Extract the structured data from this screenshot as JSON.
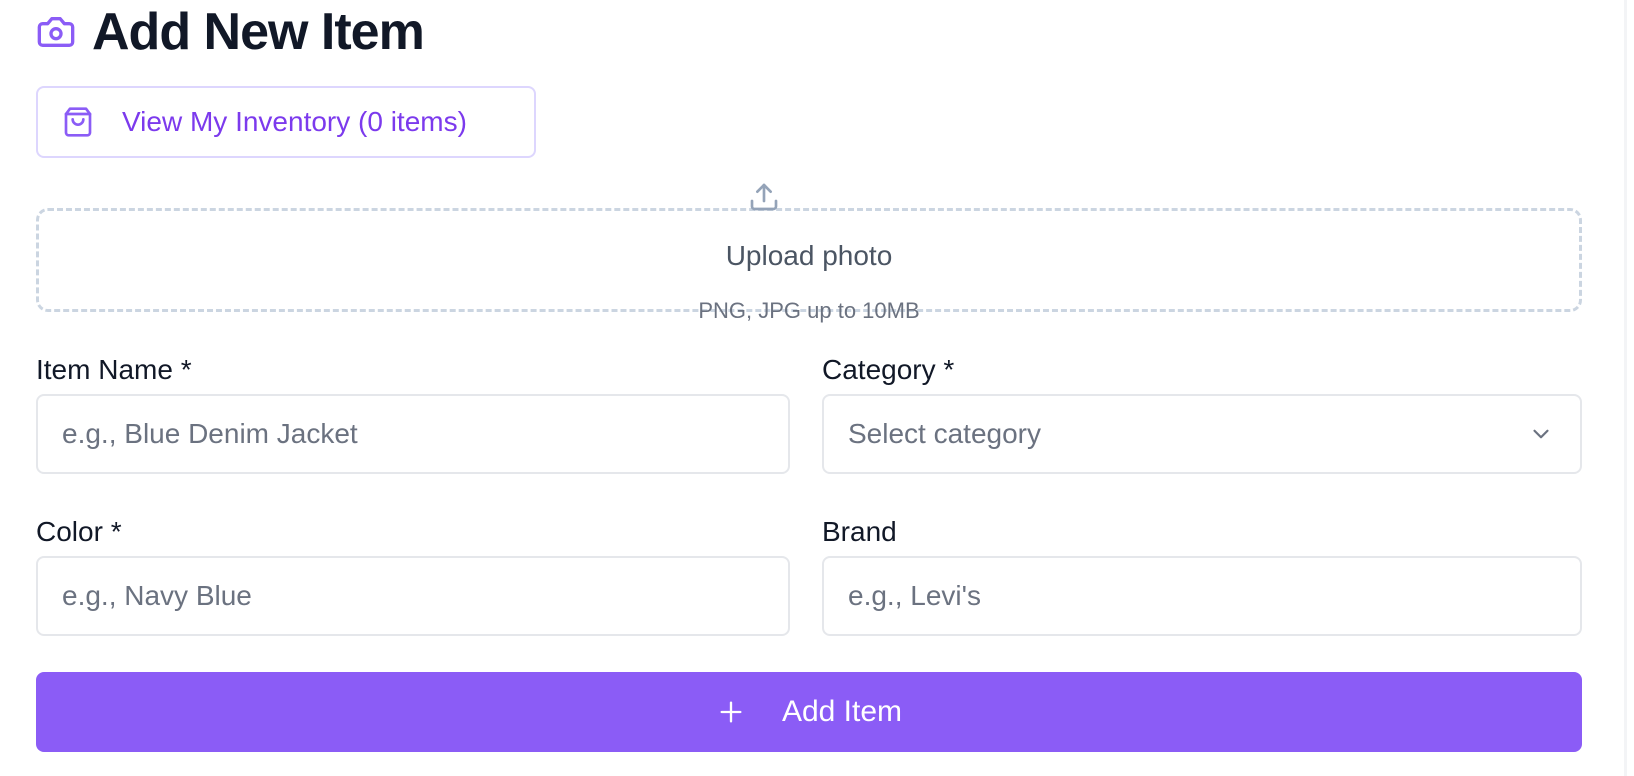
{
  "header": {
    "title": "Add New Item",
    "icon": "camera-icon"
  },
  "inventory_button": {
    "label": "View My Inventory (0 items)",
    "icon": "shopping-bag-icon"
  },
  "upload": {
    "icon": "upload-icon",
    "title": "Upload photo",
    "subtitle": "PNG, JPG up to 10MB"
  },
  "form": {
    "item_name": {
      "label": "Item Name *",
      "placeholder": "e.g., Blue Denim Jacket",
      "value": ""
    },
    "category": {
      "label": "Category *",
      "placeholder": "Select category",
      "icon": "chevron-down-icon"
    },
    "color": {
      "label": "Color *",
      "placeholder": "e.g., Navy Blue",
      "value": ""
    },
    "brand": {
      "label": "Brand",
      "placeholder": "e.g., Levi's",
      "value": ""
    }
  },
  "submit_button": {
    "label": "Add Item",
    "icon": "plus-icon"
  },
  "colors": {
    "accent": "#8b5cf6",
    "accent_text": "#7c3aed",
    "border": "#e5e7eb",
    "dashed_border": "#cbd5e1"
  }
}
